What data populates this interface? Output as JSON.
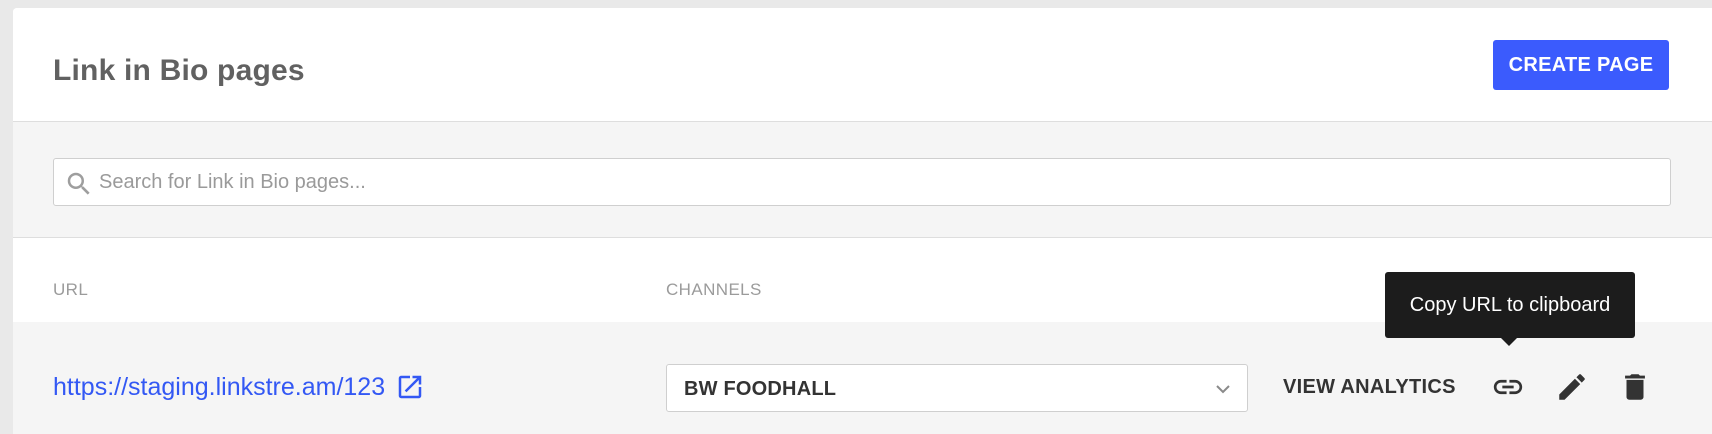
{
  "header": {
    "title": "Link in Bio pages",
    "create_label": "CREATE PAGE"
  },
  "search": {
    "placeholder": "Search for Link in Bio pages...",
    "value": ""
  },
  "table": {
    "columns": [
      "URL",
      "CHANNELS"
    ],
    "rows": [
      {
        "url": "https://staging.linkstre.am/123",
        "channel": "BW FOODHALL",
        "analytics_label": "VIEW ANALYTICS"
      }
    ]
  },
  "tooltip": {
    "text": "Copy URL to clipboard"
  },
  "colors": {
    "accent": "#3b5bfd",
    "link": "#3358f4",
    "tooltip_bg": "#1c1c1c"
  },
  "icons": [
    "search-icon",
    "external-link-icon",
    "chevron-down-icon",
    "link-icon",
    "pencil-icon",
    "trash-icon"
  ]
}
